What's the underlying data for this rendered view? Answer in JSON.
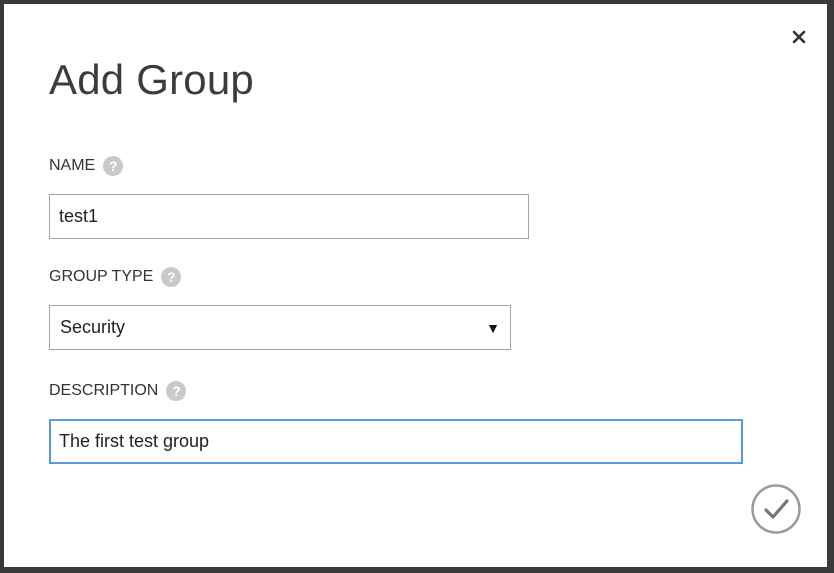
{
  "dialog": {
    "title": "Add Group",
    "close_icon": "close-icon",
    "submit_icon": "checkmark-icon"
  },
  "fields": {
    "name": {
      "label": "NAME",
      "value": "test1",
      "help_icon": "help-icon"
    },
    "group_type": {
      "label": "GROUP TYPE",
      "selected": "Security",
      "help_icon": "help-icon"
    },
    "description": {
      "label": "DESCRIPTION",
      "value": "The first test group",
      "help_icon": "help-icon"
    }
  },
  "colors": {
    "overlay": "#3a3a3a",
    "focus_border": "#5a9ad8",
    "help_icon_bg": "#c9c9c9",
    "text": "#333333"
  }
}
